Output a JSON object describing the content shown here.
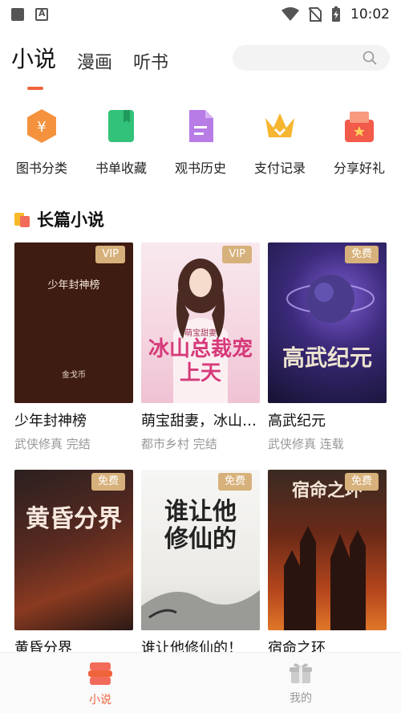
{
  "status_bar": {
    "time": "10:02"
  },
  "top_tabs": [
    {
      "label": "小说",
      "active": true
    },
    {
      "label": "漫画",
      "active": false
    },
    {
      "label": "听书",
      "active": false
    }
  ],
  "quick_menu": [
    {
      "label": "图书分类",
      "icon": "category-icon",
      "color": "#f5923e"
    },
    {
      "label": "书单收藏",
      "icon": "bookmark-book-icon",
      "color": "#33c27a"
    },
    {
      "label": "观书历史",
      "icon": "history-doc-icon",
      "color": "#b77ce6"
    },
    {
      "label": "支付记录",
      "icon": "crown-icon",
      "color": "#f6b630"
    },
    {
      "label": "分享好礼",
      "icon": "gift-share-icon",
      "color": "#f25a4a"
    }
  ],
  "section": {
    "title": "长篇小说"
  },
  "books": [
    {
      "title": "少年封神榜",
      "meta": "武侠修真 完结",
      "badge": "VIP",
      "cover_title": "少年封神榜",
      "cover_author": "金戈币"
    },
    {
      "title": "萌宝甜妻，冰山总裁宠上天",
      "meta": "都市乡村 完结",
      "badge": "VIP",
      "cover_title": "冰山总裁宠上天",
      "cover_author": "萌宝甜妻"
    },
    {
      "title": "高武纪元",
      "meta": "武侠修真 连载",
      "badge": "免费",
      "cover_title": "高武纪元",
      "cover_author": ""
    },
    {
      "title": "黄昏分界",
      "meta": "",
      "badge": "免费",
      "cover_title": "黄昏分界",
      "cover_author": ""
    },
    {
      "title": "谁让他修仙的！",
      "meta": "",
      "badge": "免费",
      "cover_title": "谁让他修仙的",
      "cover_author": ""
    },
    {
      "title": "宿命之环",
      "meta": "",
      "badge": "免费",
      "cover_title": "宿命之环",
      "cover_author": ""
    }
  ],
  "bottom_nav": [
    {
      "label": "小说",
      "active": true
    },
    {
      "label": "我的",
      "active": false
    }
  ],
  "colors": {
    "accent": "#f0643c",
    "badge": "#d7b17b"
  }
}
